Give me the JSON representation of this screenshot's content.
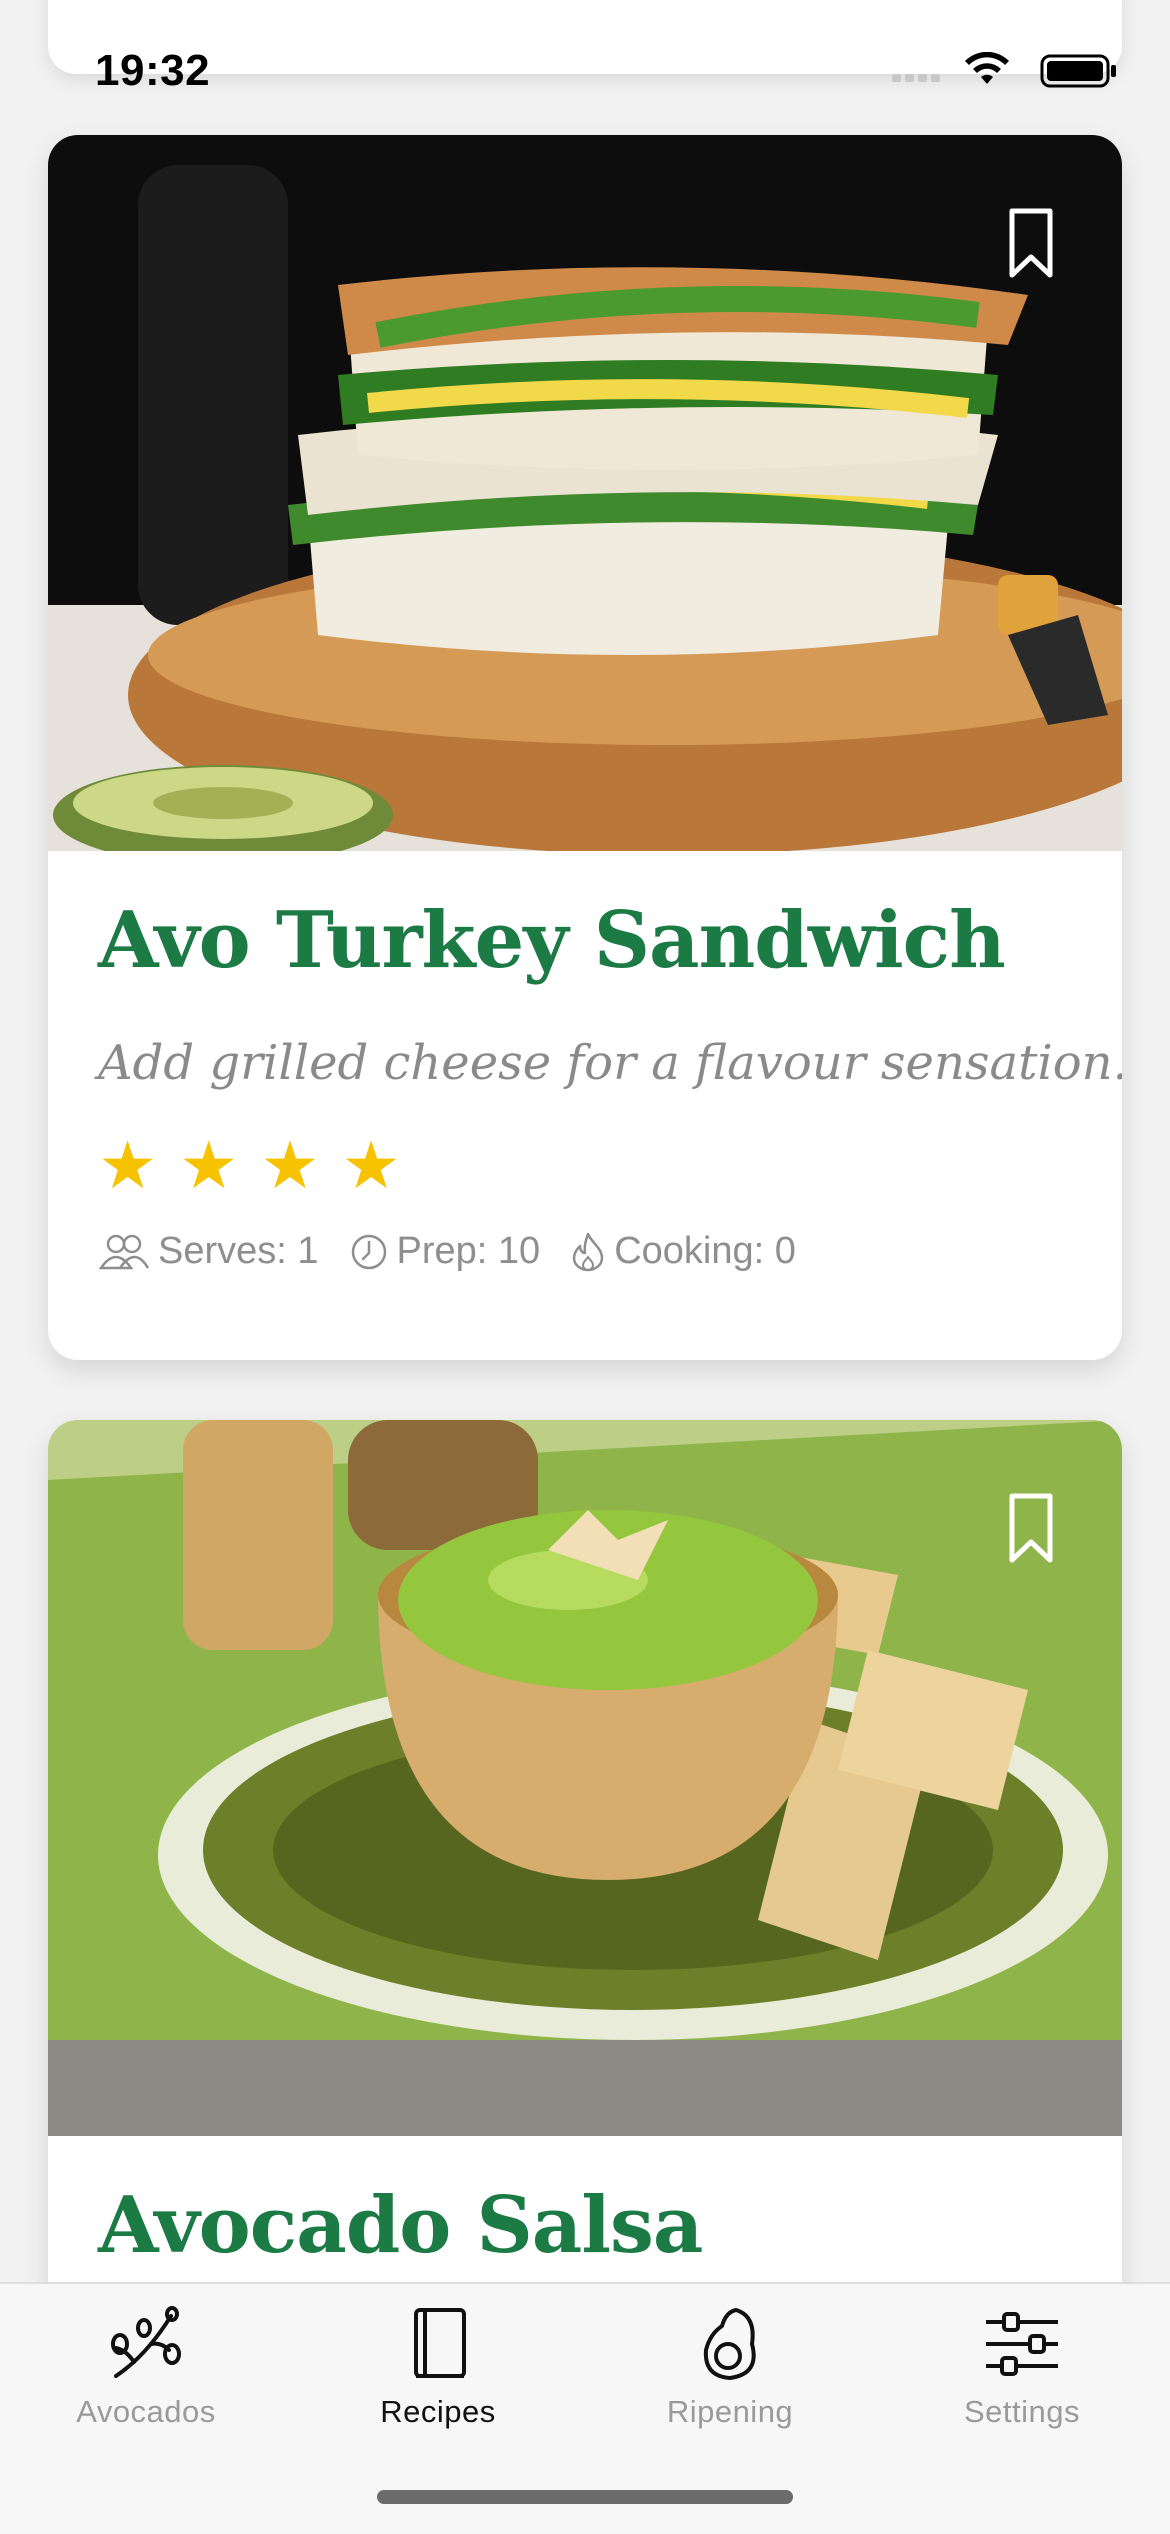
{
  "status": {
    "time": "19:32"
  },
  "recipes": [
    {
      "title": "Avo Turkey Sandwich",
      "description": "Add grilled cheese for a flavour sensation.",
      "rating": 4,
      "serves": "Serves: 1",
      "prep": "Prep: 10",
      "cooking": "Cooking: 0",
      "image": "stacked grilled sandwich with avocado and greens on wooden board"
    },
    {
      "title": "Avocado Salsa",
      "image": "bowl of avocado salsa topped with almonds with crackers on green placemat"
    }
  ],
  "tabs": [
    {
      "label": "Avocados",
      "icon": "avocado-branch-icon",
      "active": false
    },
    {
      "label": "Recipes",
      "icon": "book-icon",
      "active": true
    },
    {
      "label": "Ripening",
      "icon": "avocado-icon",
      "active": false
    },
    {
      "label": "Settings",
      "icon": "sliders-icon",
      "active": false
    }
  ],
  "colors": {
    "title_green": "#1c7a45",
    "star_yellow": "#f7c300",
    "muted_text": "#8a8a8a",
    "background": "#f2f2f2"
  }
}
